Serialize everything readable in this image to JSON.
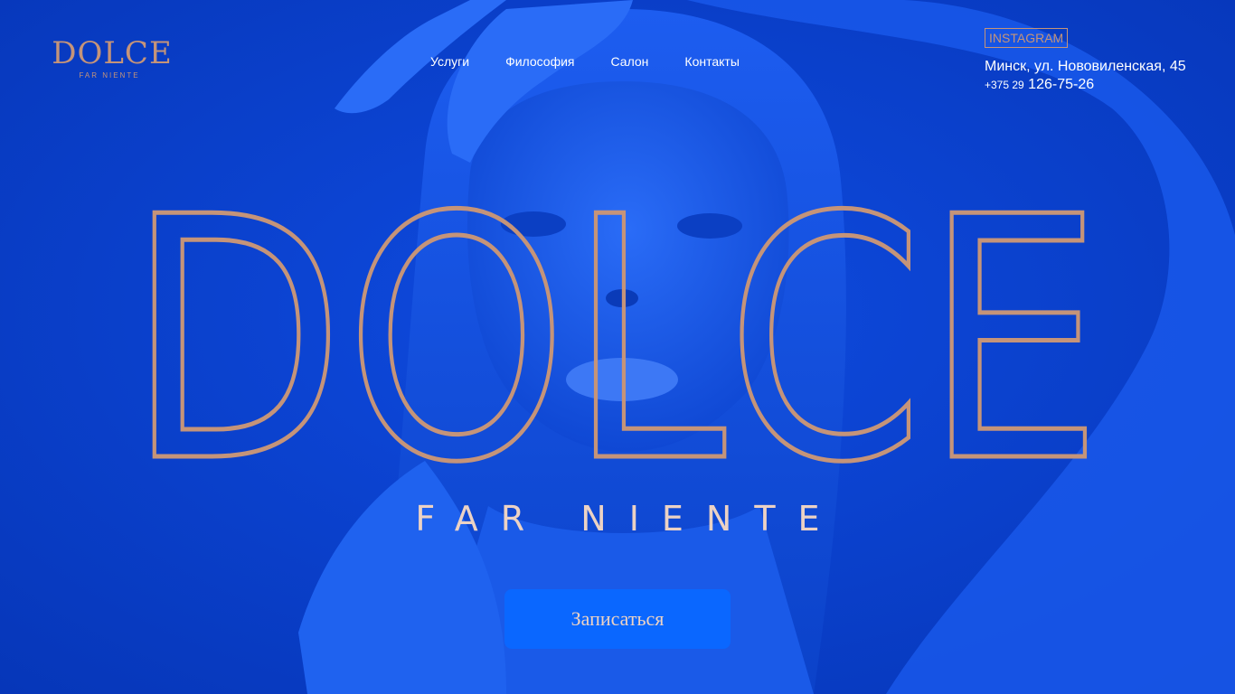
{
  "brand": {
    "logo_main": "DOLCE",
    "logo_sub": "FAR NIENTE",
    "accent_color": "#c59479",
    "background_color": "#0a3fd0",
    "button_color": "#0a67ff"
  },
  "nav": {
    "items": [
      {
        "label": "Услуги"
      },
      {
        "label": "Философия"
      },
      {
        "label": "Салон"
      },
      {
        "label": "Контакты"
      }
    ]
  },
  "contact": {
    "instagram_label": "INSTAGRAM",
    "address": "Минск, ул. Нововиленская, 45",
    "phone_code": "+375 29",
    "phone_number": "126-75-26"
  },
  "hero": {
    "title": "DOLCE",
    "tagline": "FAR NIENTE",
    "cta_label": "Записаться"
  }
}
